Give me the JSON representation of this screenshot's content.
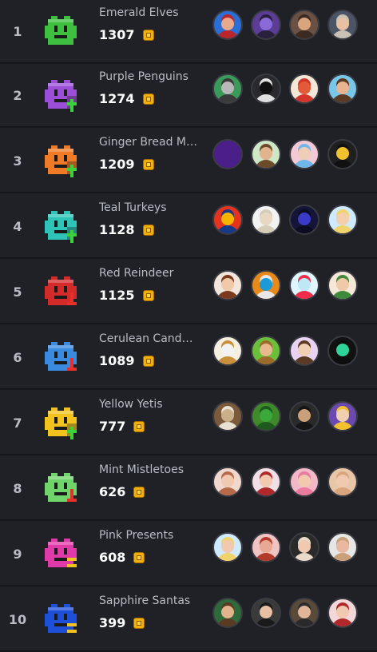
{
  "teams": [
    {
      "rank": "1",
      "name": "Emerald Elves",
      "score": "1307",
      "icon": "emerald-elf-icon",
      "color": "#3fbf3f",
      "trend": "none",
      "avatars": [
        {
          "bg": "#2b6fd6",
          "skin": "#e9a98c",
          "hair": "#b8262b"
        },
        {
          "bg": "#5b3c97",
          "skin": "#8a6ad8",
          "hair": "#2a1f3d"
        },
        {
          "bg": "#6a5143",
          "skin": "#d9a57f",
          "hair": "#3b2a20"
        },
        {
          "bg": "#4c5566",
          "skin": "#e8c0a4",
          "hair": "#c9c2b5"
        }
      ]
    },
    {
      "rank": "2",
      "name": "Purple Penguins",
      "score": "1274",
      "icon": "purple-penguin-icon",
      "color": "#9b4fd8",
      "trend": "up",
      "avatars": [
        {
          "bg": "#3a9a5a",
          "skin": "#b8b8b8",
          "hair": "#3a3a3a"
        },
        {
          "bg": "#2a2a2e",
          "skin": "#101010",
          "hair": "#e0e0e0"
        },
        {
          "bg": "#f5e7d8",
          "skin": "#e35a3a",
          "hair": "#d4352b"
        },
        {
          "bg": "#78c6e8",
          "skin": "#e9b48f",
          "hair": "#5b3a22"
        }
      ]
    },
    {
      "rank": "3",
      "name": "Ginger Bread Men",
      "score": "1209",
      "icon": "ginger-bread-icon",
      "color": "#f07a26",
      "trend": "up",
      "avatars": [
        {
          "bg": "#4a1f8a",
          "skin": "#4a1f8a",
          "hair": "#4a1f8a"
        },
        {
          "bg": "#cfe7c7",
          "skin": "#e2b48e",
          "hair": "#6c4a2a"
        },
        {
          "bg": "#f4c9d6",
          "skin": "#f0cdb7",
          "hair": "#6fb7e8"
        },
        {
          "bg": "#1f1f1f",
          "skin": "#f2c12e",
          "hair": "#111111"
        }
      ]
    },
    {
      "rank": "4",
      "name": "Teal Turkeys",
      "score": "1128",
      "icon": "teal-turkey-icon",
      "color": "#2ec4b8",
      "trend": "up",
      "avatars": [
        {
          "bg": "#e5331d",
          "skin": "#f7b500",
          "hair": "#163a8a"
        },
        {
          "bg": "#f2f2f2",
          "skin": "#e8d7c2",
          "hair": "#d6cdb8"
        },
        {
          "bg": "#15153a",
          "skin": "#3a3ac7",
          "hair": "#0b0b22"
        },
        {
          "bg": "#cfe9ff",
          "skin": "#f3cfad",
          "hair": "#f0d36a"
        }
      ]
    },
    {
      "rank": "5",
      "name": "Red Reindeer",
      "score": "1125",
      "icon": "red-reindeer-icon",
      "color": "#d32a2a",
      "trend": "down",
      "avatars": [
        {
          "bg": "#f2e6dc",
          "skin": "#f0c9a8",
          "hair": "#7b3a1e"
        },
        {
          "bg": "#e88a1a",
          "skin": "#1a9ad6",
          "hair": "#e8e8e8"
        },
        {
          "bg": "#dff6ff",
          "skin": "#bfe8f7",
          "hair": "#ef2d4a"
        },
        {
          "bg": "#f5e8d8",
          "skin": "#f0c9a8",
          "hair": "#3f8a3a"
        }
      ]
    },
    {
      "rank": "6",
      "name": "Cerulean Candy Canes",
      "score": "1089",
      "icon": "candy-cane-icon",
      "color": "#3a8ae0",
      "trend": "down",
      "avatars": [
        {
          "bg": "#f5efe0",
          "skin": "#f2f2f2",
          "hair": "#c98f3a"
        },
        {
          "bg": "#6cbf3a",
          "skin": "#e6b98e",
          "hair": "#9c6a2a"
        },
        {
          "bg": "#e8d4f2",
          "skin": "#f1cfb2",
          "hair": "#5a3a22"
        },
        {
          "bg": "#111111",
          "skin": "#2fd49a",
          "hair": "#0d0d0d"
        }
      ]
    },
    {
      "rank": "7",
      "name": "Yellow Yetis",
      "score": "777",
      "icon": "yellow-yeti-icon",
      "color": "#f2c21e",
      "trend": "up",
      "avatars": [
        {
          "bg": "#7a5a3a",
          "skin": "#c9b08a",
          "hair": "#e8e0d0"
        },
        {
          "bg": "#3f8a2a",
          "skin": "#3aa83a",
          "hair": "#1e5a1e"
        },
        {
          "bg": "#2a2a2a",
          "skin": "#c9a07a",
          "hair": "#151515"
        },
        {
          "bg": "#6a4ab0",
          "skin": "#f1cfb2",
          "hair": "#f2c12e"
        }
      ]
    },
    {
      "rank": "8",
      "name": "Mint Mistletoes",
      "score": "626",
      "icon": "mistletoe-icon",
      "color": "#6fd46a",
      "trend": "down",
      "avatars": [
        {
          "bg": "#f0d8cf",
          "skin": "#f0c9b0",
          "hair": "#b56a4a"
        },
        {
          "bg": "#f2dfe6",
          "skin": "#f0c9b0",
          "hair": "#b0282a"
        },
        {
          "bg": "#f2b8c8",
          "skin": "#f0c9b0",
          "hair": "#e97aa0"
        },
        {
          "bg": "#e8c7a8",
          "skin": "#f0c9b0",
          "hair": "#d9a57f"
        }
      ]
    },
    {
      "rank": "9",
      "name": "Pink Presents",
      "score": "608",
      "icon": "pink-present-icon",
      "color": "#e03aa8",
      "trend": "same",
      "avatars": [
        {
          "bg": "#cfe9ff",
          "skin": "#f0c9b0",
          "hair": "#f0d36a"
        },
        {
          "bg": "#f2c3c3",
          "skin": "#e7a996",
          "hair": "#b33a2a"
        },
        {
          "bg": "#2a2a2a",
          "skin": "#f0c9b0",
          "hair": "#e9d9c9"
        },
        {
          "bg": "#e6e6e6",
          "skin": "#e9b8a0",
          "hair": "#c9a07a"
        }
      ]
    },
    {
      "rank": "10",
      "name": "Sapphire Santas",
      "score": "399",
      "icon": "sapphire-santa-icon",
      "color": "#1e4fd8",
      "trend": "same",
      "avatars": [
        {
          "bg": "#2e6a3a",
          "skin": "#e2b48e",
          "hair": "#5a3a22"
        },
        {
          "bg": "#3a3a3a",
          "skin": "#e8c0a4",
          "hair": "#1a1a1a"
        },
        {
          "bg": "#5a4a3a",
          "skin": "#e1b597",
          "hair": "#2a2a2a"
        },
        {
          "bg": "#f2d8d8",
          "skin": "#f0c9b0",
          "hair": "#b0282a"
        }
      ]
    }
  ]
}
